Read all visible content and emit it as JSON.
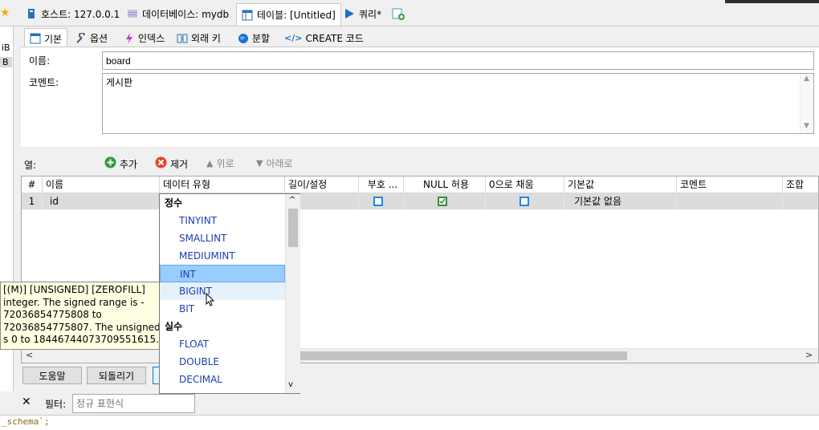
{
  "top_tabs": [
    {
      "label": "호스트: 127.0.0.1",
      "icon": "host-icon"
    },
    {
      "label": "데이터베이스: mydb",
      "icon": "database-icon"
    },
    {
      "label": "테이블: [Untitled]",
      "icon": "table-icon"
    },
    {
      "label": "쿼리*",
      "icon": "query-play-icon"
    }
  ],
  "left_strip": {
    "line1": "iB",
    "line2": "B"
  },
  "inner_tabs": [
    {
      "label": "기본",
      "icon": "basic-icon"
    },
    {
      "label": "옵션",
      "icon": "wrench-icon"
    },
    {
      "label": "인덱스",
      "icon": "lightning-icon"
    },
    {
      "label": "외래 키",
      "icon": "foreign-key-icon"
    },
    {
      "label": "분할",
      "icon": "globe-icon"
    },
    {
      "label": "CREATE 코드",
      "icon": "code-icon"
    }
  ],
  "basic": {
    "name_label": "이름:",
    "name_value": "board",
    "comment_label": "코멘트:",
    "comment_value": "게시판"
  },
  "columns_toolbar": {
    "label": "열:",
    "add": "추가",
    "remove": "제거",
    "up": "위로",
    "down": "아래로"
  },
  "grid": {
    "headers": [
      "#",
      "이름",
      "데이터 유형",
      "길이/설정",
      "부호 ...",
      "NULL 허용",
      "0으로 채움",
      "기본값",
      "코멘트",
      "조합"
    ],
    "rows": [
      {
        "num": "1",
        "name": "id",
        "unsigned": false,
        "allow_null": true,
        "zerofill": false,
        "default": "기본값 없음"
      }
    ]
  },
  "datatype_dropdown": {
    "groups": [
      {
        "label": "정수",
        "items": [
          "TINYINT",
          "SMALLINT",
          "MEDIUMINT",
          "INT",
          "BIGINT",
          "BIT"
        ]
      },
      {
        "label": "실수",
        "items": [
          "FLOAT",
          "DOUBLE",
          "DECIMAL"
        ]
      }
    ],
    "selected": "INT",
    "hovered": "BIGINT"
  },
  "tooltip": {
    "lines": [
      "[(M)] [UNSIGNED] [ZEROFILL]",
      " integer. The signed range is -",
      "72036854775808 to",
      "72036854775807. The unsigned",
      "s 0 to 18446744073709551615."
    ]
  },
  "buttons": {
    "help": "도움말",
    "revert": "되돌리기"
  },
  "filter": {
    "label": "필터:",
    "placeholder": "정규 표현식"
  },
  "bottom_text": "_schema`;",
  "colors": {
    "accent": "#1e88e5",
    "selection": "#99ccff",
    "tooltip_bg": "#ffffe1",
    "row_bg": "#dcdcdc"
  }
}
